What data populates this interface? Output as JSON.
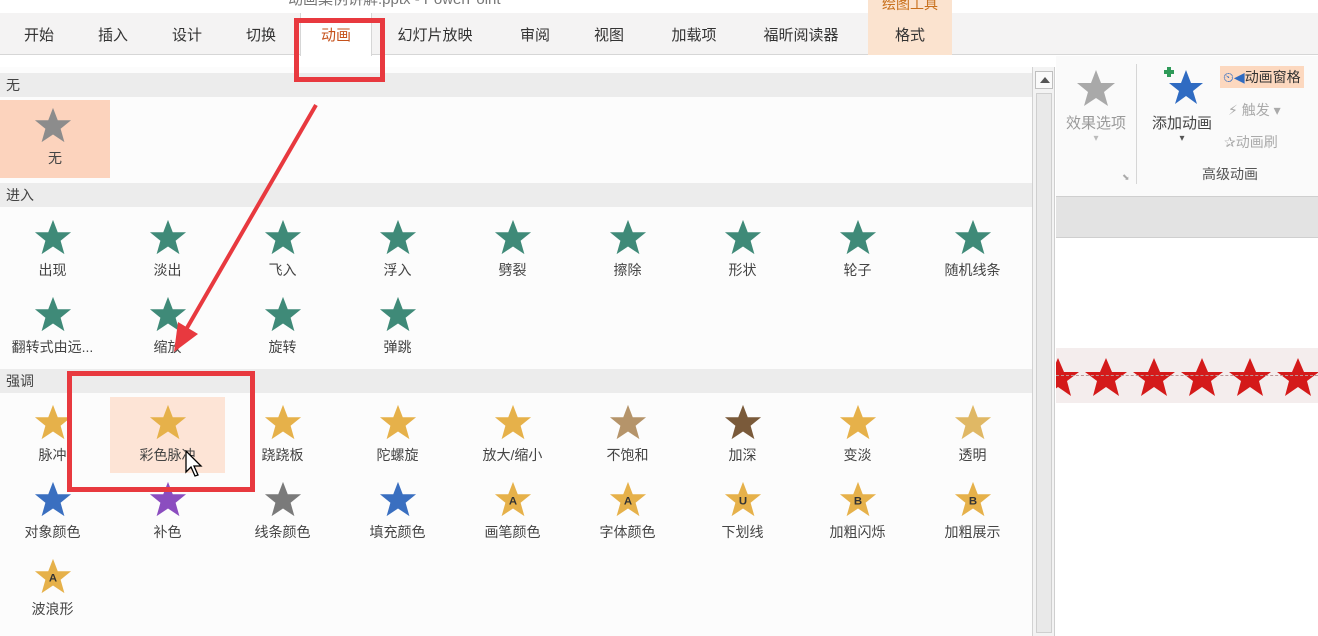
{
  "window": {
    "title": "动画案例讲解.pptx - PowerPoint",
    "context_tab_title": "绘图工具"
  },
  "tabs": [
    "开始",
    "插入",
    "设计",
    "切换",
    "动画",
    "幻灯片放映",
    "审阅",
    "视图",
    "加载项",
    "福昕阅读器",
    "格式"
  ],
  "active_tab": "动画",
  "gallery": {
    "none_section": "无",
    "none_item": "无",
    "entrance_section": "进入",
    "entrance_items": [
      "出现",
      "淡出",
      "飞入",
      "浮入",
      "劈裂",
      "擦除",
      "形状",
      "轮子",
      "随机线条",
      "翻转式由远...",
      "缩放",
      "旋转",
      "弹跳"
    ],
    "emphasis_section": "强调",
    "emphasis_items": [
      "脉冲",
      "彩色脉冲",
      "跷跷板",
      "陀螺旋",
      "放大/缩小",
      "不饱和",
      "加深",
      "变淡",
      "透明",
      "对象颜色",
      "补色",
      "线条颜色",
      "填充颜色",
      "画笔颜色",
      "字体颜色",
      "下划线",
      "加粗闪烁",
      "加粗展示",
      "波浪形"
    ],
    "hovered_item": "彩色脉冲"
  },
  "ribbon_right": {
    "effect_options": "效果选项",
    "add_animation": "添加动画",
    "animation_pane": "动画窗格",
    "trigger": "触发",
    "animation_painter": "动画刷",
    "advanced_group_label": "高级动画"
  },
  "colors": {
    "entrance_star": "#3f8a78",
    "emphasis_star": "#e6b14a",
    "accent_orange": "#c5521c",
    "highlight_red": "#e8393f",
    "slide_star": "#d41a1a"
  }
}
